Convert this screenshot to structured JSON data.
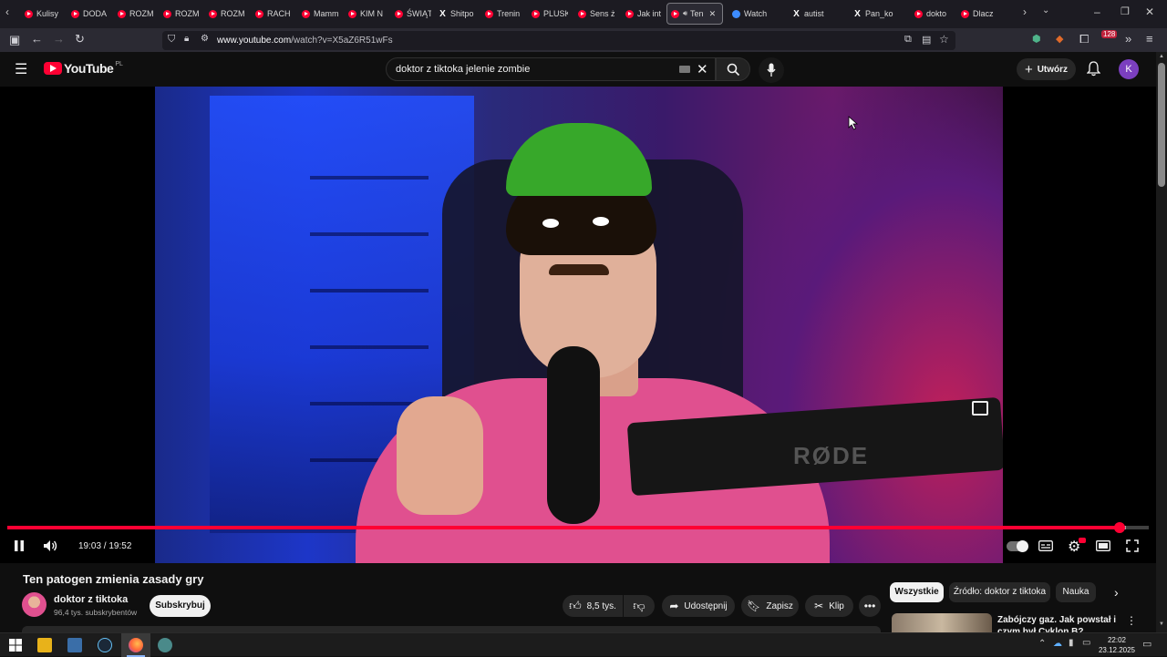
{
  "browser": {
    "tabs": [
      {
        "label": "Kulisy",
        "icon": "youtube"
      },
      {
        "label": "DODA",
        "icon": "youtube"
      },
      {
        "label": "ROZM",
        "icon": "youtube"
      },
      {
        "label": "ROZM",
        "icon": "youtube"
      },
      {
        "label": "ROZM",
        "icon": "youtube"
      },
      {
        "label": "RACH",
        "icon": "youtube"
      },
      {
        "label": "Mamm",
        "icon": "youtube"
      },
      {
        "label": "KIM N",
        "icon": "youtube"
      },
      {
        "label": "ŚWIĄT",
        "icon": "youtube"
      },
      {
        "label": "Shitpo",
        "icon": "x"
      },
      {
        "label": "Trenin",
        "icon": "youtube"
      },
      {
        "label": "PLUSK",
        "icon": "youtube"
      },
      {
        "label": "Sens ż",
        "icon": "youtube"
      },
      {
        "label": "Jak int",
        "icon": "youtube"
      },
      {
        "label": "Ten",
        "icon": "youtube",
        "active": true
      },
      {
        "label": "Watch",
        "icon": "blue"
      },
      {
        "label": "autist",
        "icon": "x"
      },
      {
        "label": "Pan_ko",
        "icon": "x"
      },
      {
        "label": "dokto",
        "icon": "youtube"
      },
      {
        "label": "Dlacz",
        "icon": "youtube"
      }
    ],
    "url_host": "www.youtube.com",
    "url_path": "/watch?v=X5aZ6R51wFs",
    "extension_badge": "128"
  },
  "youtube": {
    "logo_text": "YouTube",
    "logo_region": "PL",
    "search_query": "doktor z tiktoka jelenie zombie",
    "create_label": "Utwórz",
    "avatar_letter": "K"
  },
  "player": {
    "progress_fraction": 0.9744,
    "buffer_fraction": 0.98,
    "time_current": "19:03",
    "time_total": "19:52",
    "time_display": "19:03 / 19:52",
    "video_overlay_text": "RØDE"
  },
  "video": {
    "title": "Ten patogen zmienia zasady gry",
    "channel_name": "doktor z tiktoka",
    "channel_subs": "96,4 tys. subskrybentów",
    "subscribe_label": "Subskrybuj",
    "likes": "8,5 tys.",
    "share_label": "Udostępnij",
    "save_label": "Zapisz",
    "clip_label": "Klip"
  },
  "recommendations": {
    "chips": [
      "Wszystkie",
      "Źródło: doktor z tiktoka",
      "Nauka"
    ],
    "first_title": "Zabójczy gaz. Jak powstał i czym był Cyklon B?"
  },
  "taskbar": {
    "time": "22:02",
    "date": "23.12.2025"
  }
}
